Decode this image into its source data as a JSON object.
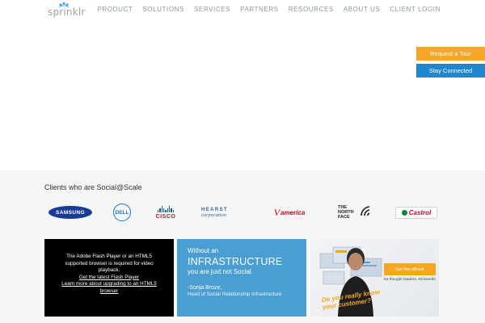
{
  "header": {
    "logo_text": "sprinklr",
    "nav": [
      "PRODUCT",
      "SOLUTIONS",
      "SERVICES",
      "PARTNERS",
      "RESOURCES",
      "ABOUT US",
      "CLIENT LOGIN"
    ]
  },
  "side_buttons": {
    "tour": "Request a Tour",
    "stay": "Stay Connected"
  },
  "clients": {
    "title": "Clients who are Social@Scale",
    "logos": {
      "samsung": "SAMSUNG",
      "dell": "DELL",
      "cisco": "CISCO",
      "hearst_1": "HEARST",
      "hearst_2": "corporation",
      "virgin_mark": "V",
      "virgin_text": "america",
      "northface_1": "THE",
      "northface_2": "NORTH",
      "northface_3": "FACE",
      "castrol": "Castrol"
    }
  },
  "tiles": {
    "flash": {
      "line1": "The Adobe Flash Player or an HTML5",
      "line2": "supported browser is required for video",
      "line3": "playback.",
      "link1": "Get the latest Flash Player",
      "link2": "Learn more about upgrading to an HTML5",
      "link3": "browser"
    },
    "quote": {
      "line1": "Without an",
      "line2": "INFRASTRUCTURE",
      "line3": "you are just not Social.",
      "author": "-Sonja Broze,",
      "role": "Head of Social Relationship Infrastructure"
    },
    "ebook": {
      "cta": "Get the eBook",
      "sub": "64 thought leaders, 60 brands",
      "tag_1": "Do you really know",
      "tag_2": "your customer?"
    }
  },
  "colors": {
    "tour_button": "#f5a623",
    "stay_button": "#1f86cf",
    "quote_tile": "#4a9ed1"
  }
}
